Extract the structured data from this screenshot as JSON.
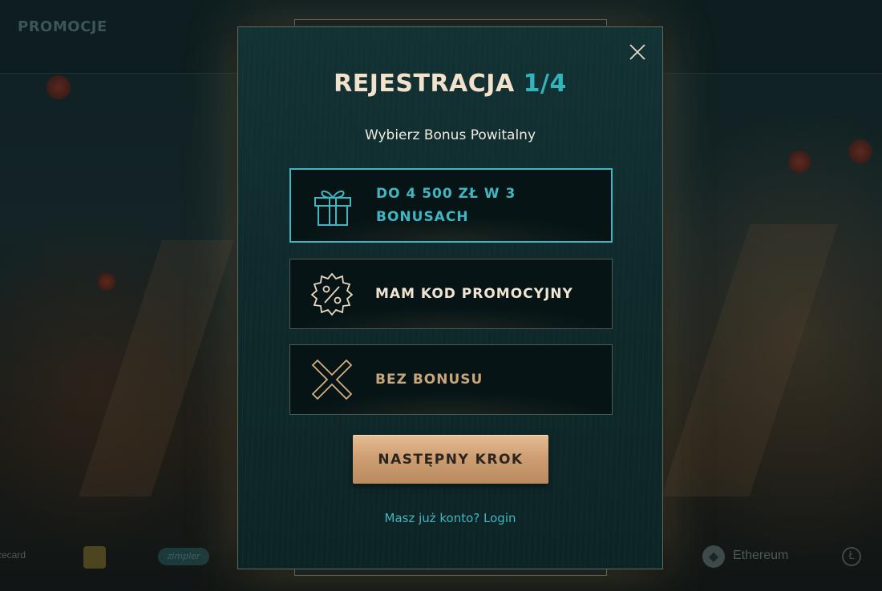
{
  "background": {
    "nav_label": "PROMOCJE",
    "payments": [
      "Ethereum",
      "zimpler",
      "zecard"
    ]
  },
  "modal": {
    "title": "REJESTRACJA",
    "step": "1/4",
    "subtitle": "Wybierz Bonus Powitalny",
    "close_icon": "close-icon",
    "options": [
      {
        "label": "DO 4 500 ZŁ W 3 BONUSACH",
        "icon": "gift-icon",
        "selected": true
      },
      {
        "label": "MAM KOD PROMOCYJNY",
        "icon": "percent-badge-icon",
        "selected": false
      },
      {
        "label": "BEZ BONUSU",
        "icon": "cross-icon",
        "selected": false
      }
    ],
    "next_button": "NASTĘPNY KROK",
    "login_prompt": "Masz już konto? Login"
  },
  "colors": {
    "accent_teal": "#3fb6c1",
    "title_cream": "#f3e2cb",
    "button_gold": "#d5a77c",
    "no_bonus_gold": "#c9a57a"
  }
}
